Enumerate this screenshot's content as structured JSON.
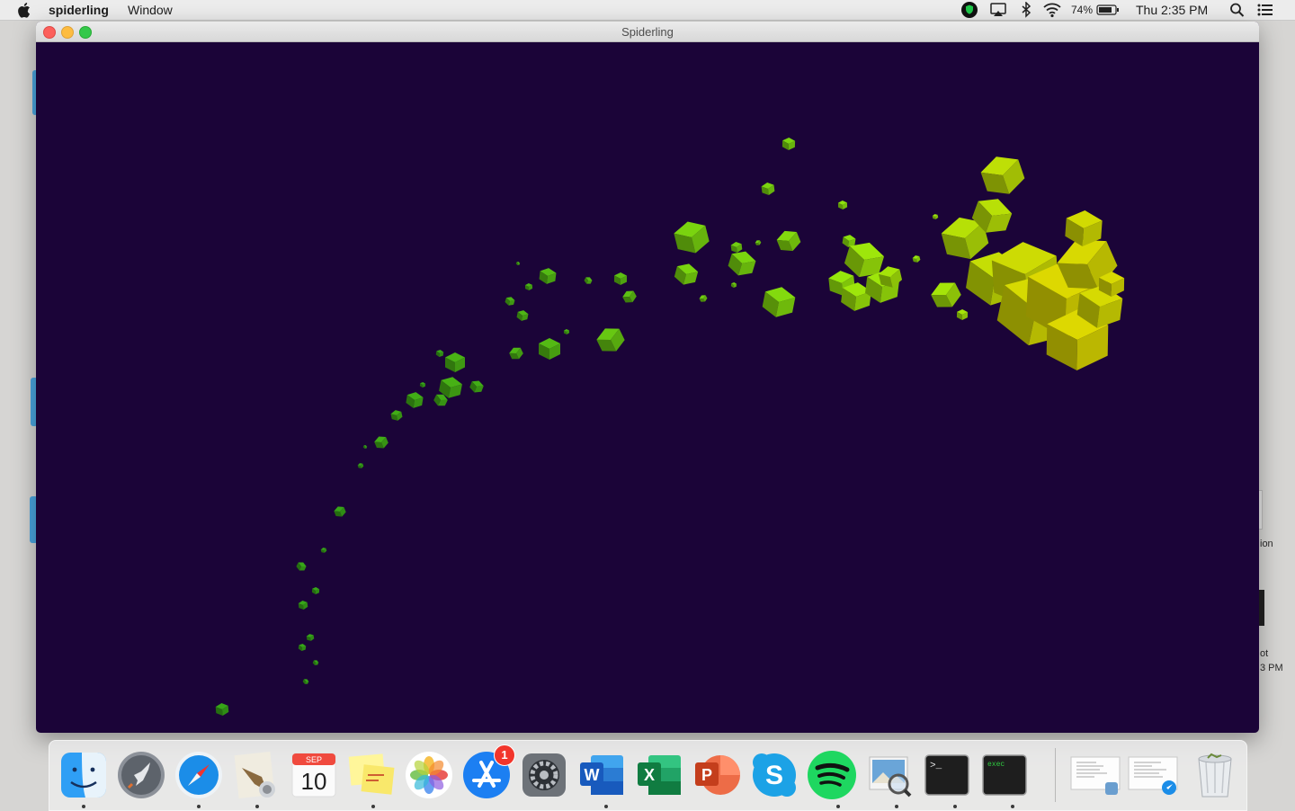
{
  "menubar": {
    "app_name": "spiderling",
    "menus": [
      "Window"
    ],
    "battery_percent": "74%",
    "clock": "Thu 2:35 PM",
    "status_icons": [
      "shield-app-icon",
      "airplay-icon",
      "bluetooth-icon",
      "wifi-icon",
      "battery-icon",
      "spotlight-search-icon",
      "notification-center-icon"
    ]
  },
  "window": {
    "title": "Spiderling",
    "background": "#1b0438"
  },
  "desktop": {
    "partial_labels": [
      "ion",
      "ot",
      "3 PM"
    ]
  },
  "scene": {
    "object": "cubes",
    "colors": {
      "green": "#3f9b17",
      "lime": "#8ccb08",
      "yellow": "#b8b500"
    }
  },
  "dock": {
    "items": [
      {
        "name": "finder-icon",
        "running": true
      },
      {
        "name": "launchpad-icon",
        "running": false
      },
      {
        "name": "safari-icon",
        "running": true
      },
      {
        "name": "mail-icon",
        "running": true
      },
      {
        "name": "calendar-icon",
        "running": false,
        "month": "SEP",
        "day": "10"
      },
      {
        "name": "stickies-icon",
        "running": true
      },
      {
        "name": "photos-icon",
        "running": false
      },
      {
        "name": "app-store-icon",
        "running": false,
        "badge": "1"
      },
      {
        "name": "system-preferences-icon",
        "running": false
      },
      {
        "name": "word-icon",
        "running": true,
        "letter": "W"
      },
      {
        "name": "excel-icon",
        "running": false,
        "letter": "X"
      },
      {
        "name": "powerpoint-icon",
        "running": false,
        "letter": "P"
      },
      {
        "name": "skype-icon",
        "running": false,
        "letter": "S"
      },
      {
        "name": "spotify-icon",
        "running": true
      },
      {
        "name": "preview-icon",
        "running": true
      },
      {
        "name": "terminal-icon",
        "running": true,
        "prompt": ">_"
      },
      {
        "name": "exec-terminal-icon",
        "running": true,
        "label": "exec"
      },
      {
        "name": "document-stack-icon",
        "running": false
      },
      {
        "name": "downloads-stack-icon",
        "running": false
      },
      {
        "name": "trash-icon",
        "running": false
      }
    ]
  }
}
